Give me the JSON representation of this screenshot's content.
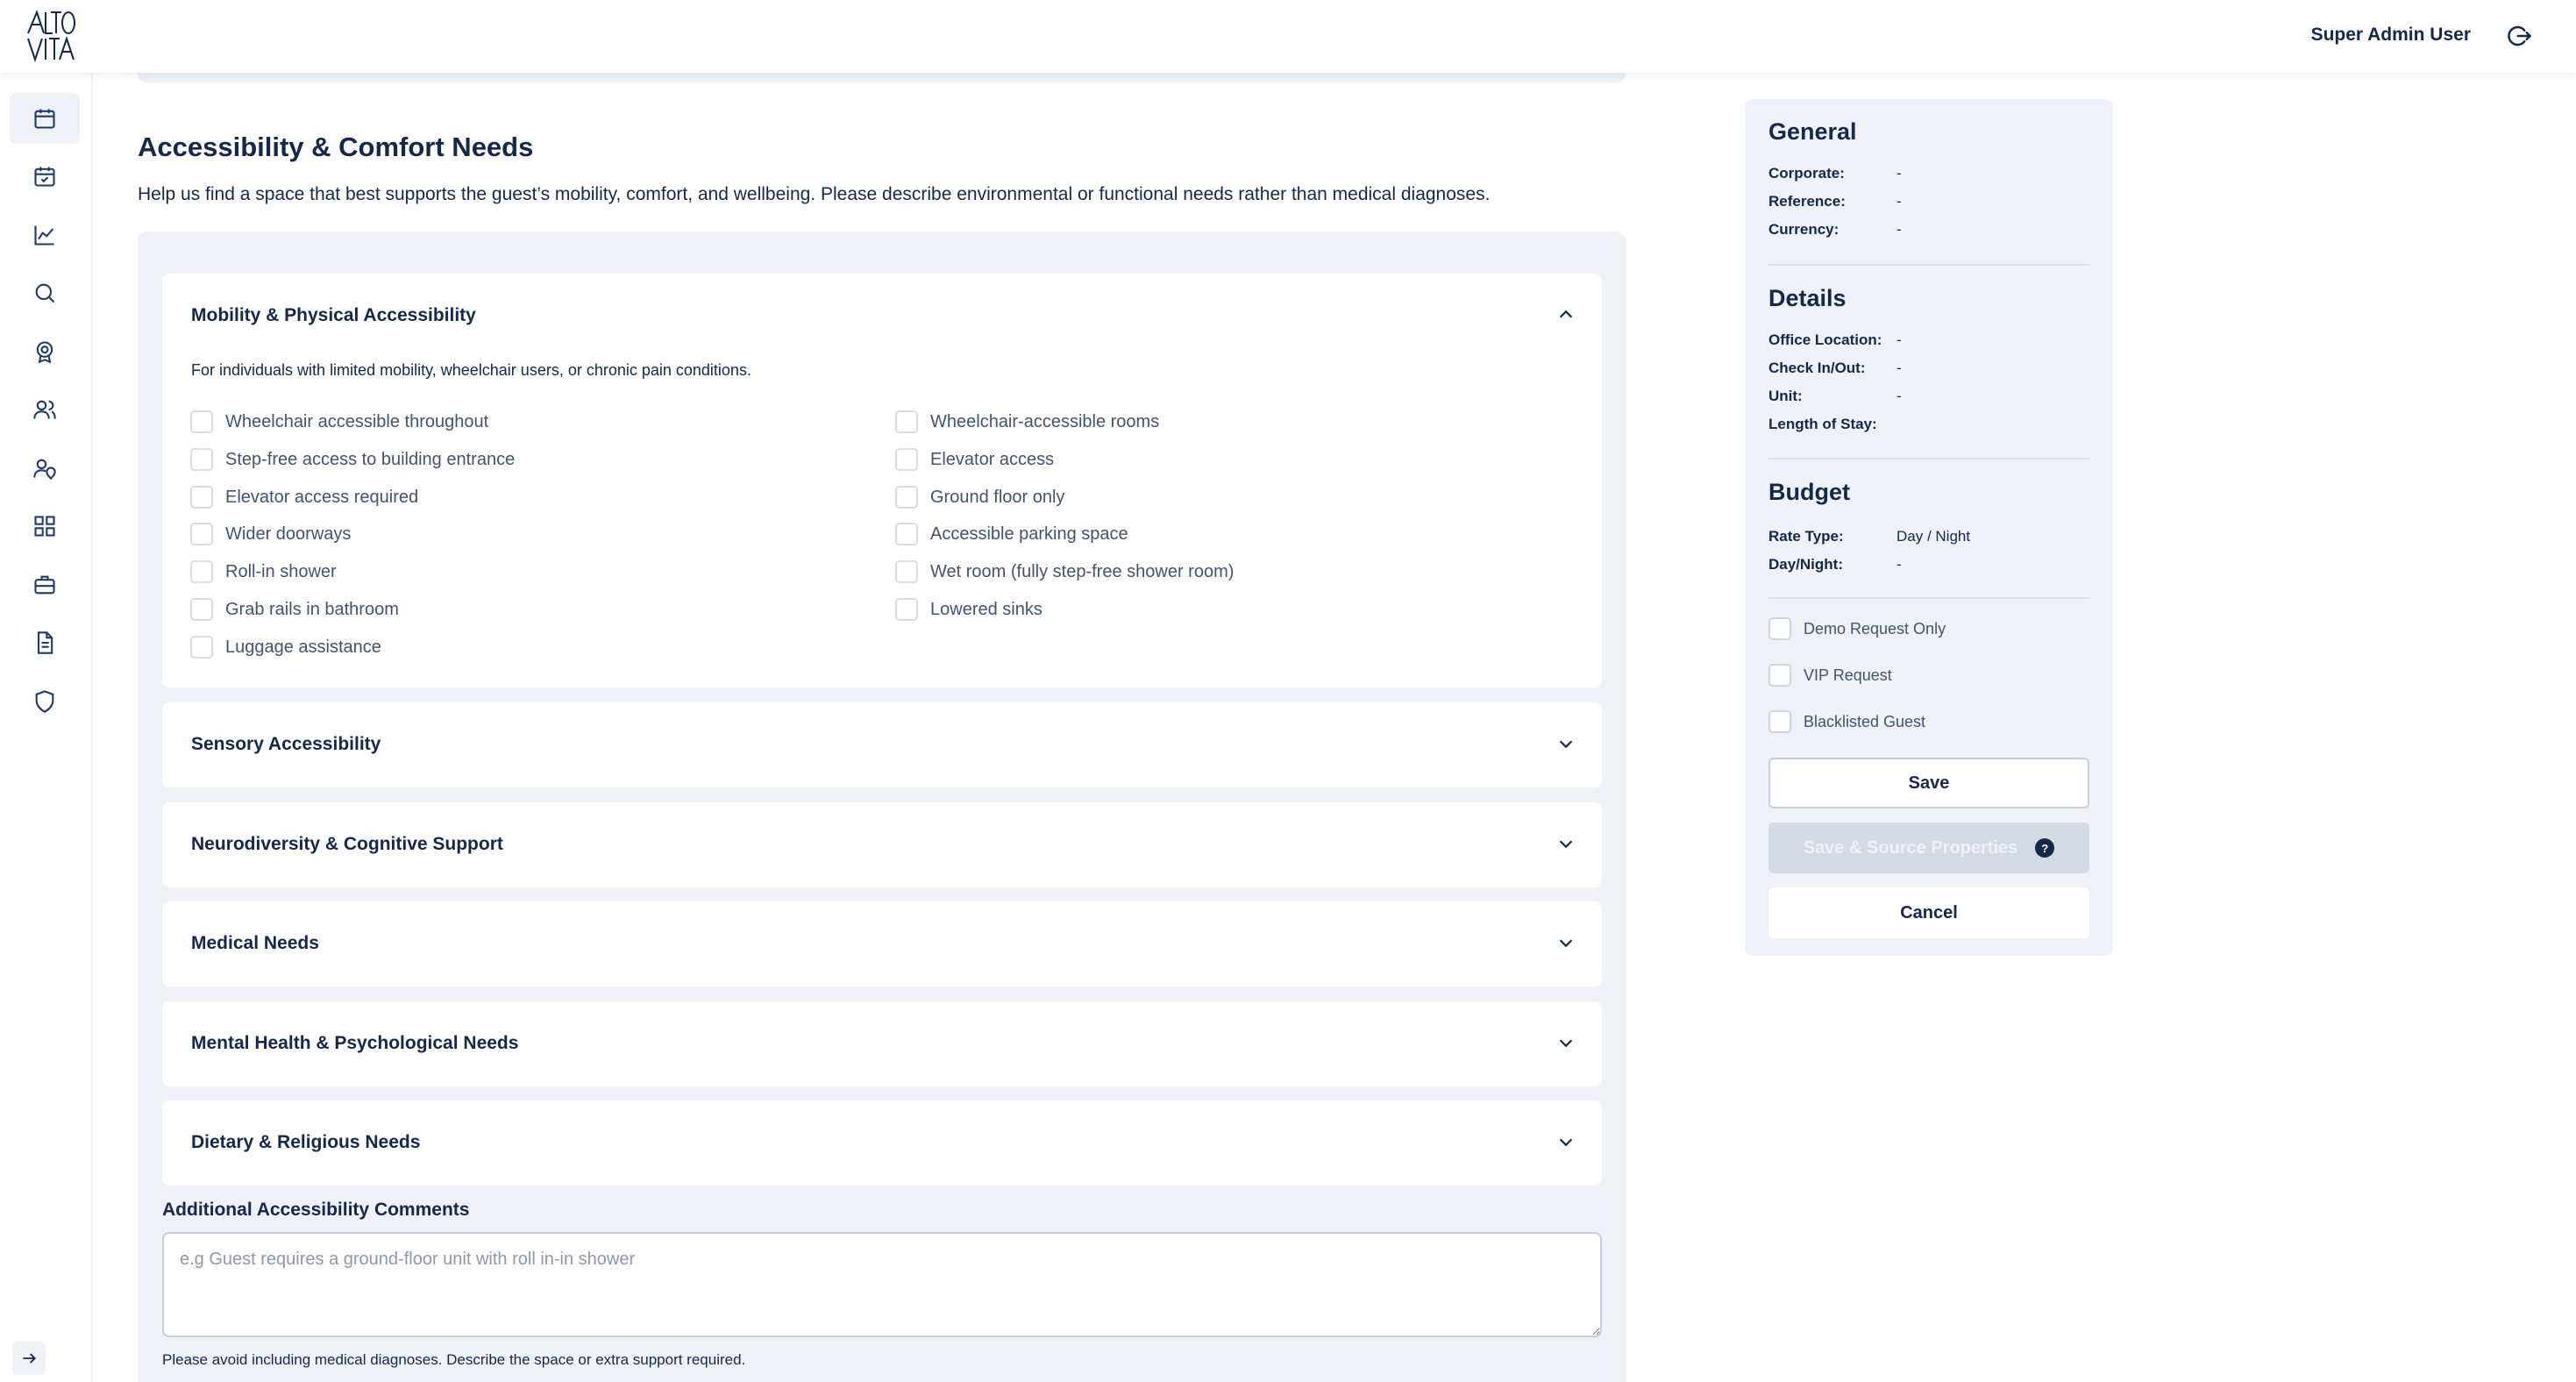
{
  "app": {
    "logo_text": "ALTO VITA",
    "user_name": "Super Admin User"
  },
  "sidebar": {
    "items": [
      {
        "icon": "calendar-icon",
        "active": true
      },
      {
        "icon": "calendar-check-icon",
        "active": false
      },
      {
        "icon": "chart-line-icon",
        "active": false
      },
      {
        "icon": "search-icon",
        "active": false
      },
      {
        "icon": "award-icon",
        "active": false
      },
      {
        "icon": "users-icon",
        "active": false
      },
      {
        "icon": "user-location-icon",
        "active": false
      },
      {
        "icon": "grid-icon",
        "active": false
      },
      {
        "icon": "briefcase-icon",
        "active": false
      },
      {
        "icon": "document-icon",
        "active": false
      },
      {
        "icon": "shield-icon",
        "active": false
      }
    ],
    "expand_icon": "arrow-right-icon"
  },
  "main": {
    "title": "Accessibility & Comfort Needs",
    "description": "Help us find a space that best supports the guest’s mobility, comfort, and wellbeing. Please describe environmental or functional needs rather than medical diagnoses.",
    "sections": {
      "mobility": {
        "title": "Mobility & Physical Accessibility",
        "expanded": true,
        "subtitle": "For individuals with limited mobility, wheelchair users, or chronic pain conditions.",
        "options_left": [
          "Wheelchair accessible throughout",
          "Step-free access to building entrance",
          "Elevator access required",
          "Wider doorways",
          "Roll-in shower",
          "Grab rails in bathroom",
          "Luggage assistance"
        ],
        "options_right": [
          "Wheelchair-accessible rooms",
          "Elevator access",
          "Ground floor only",
          "Accessible parking space",
          "Wet room (fully step-free shower room)",
          "Lowered sinks"
        ]
      },
      "sensory": {
        "title": "Sensory Accessibility",
        "expanded": false
      },
      "neuro": {
        "title": "Neurodiversity & Cognitive Support",
        "expanded": false
      },
      "medical": {
        "title": "Medical Needs",
        "expanded": false
      },
      "mental": {
        "title": "Mental Health & Psychological Needs",
        "expanded": false
      },
      "dietary": {
        "title": "Dietary & Religious Needs",
        "expanded": false
      }
    },
    "comments": {
      "label": "Additional Accessibility Comments",
      "placeholder": "e.g Guest requires a ground-floor unit with roll in-in shower",
      "value": "",
      "hint": "Please avoid including medical diagnoses. Describe the space or extra support required."
    }
  },
  "summary": {
    "general": {
      "title": "General",
      "rows": [
        {
          "key": "Corporate:",
          "value": "-"
        },
        {
          "key": "Reference:",
          "value": "-"
        },
        {
          "key": "Currency:",
          "value": "-"
        }
      ]
    },
    "details": {
      "title": "Details",
      "rows": [
        {
          "key": "Office Location:",
          "value": "-"
        },
        {
          "key": "Check In/Out:",
          "value": "-"
        },
        {
          "key": "Unit:",
          "value": "-"
        },
        {
          "key": "Length of Stay:",
          "value": ""
        }
      ]
    },
    "budget": {
      "title": "Budget",
      "rows": [
        {
          "key": "Rate Type:",
          "value": "Day / Night"
        },
        {
          "key": "Day/Night:",
          "value": "-"
        }
      ]
    },
    "flags": [
      "Demo Request Only",
      "VIP Request",
      "Blacklisted Guest"
    ],
    "buttons": {
      "save": "Save",
      "save_source": "Save & Source Properties",
      "save_source_help": "?",
      "cancel": "Cancel"
    }
  }
}
